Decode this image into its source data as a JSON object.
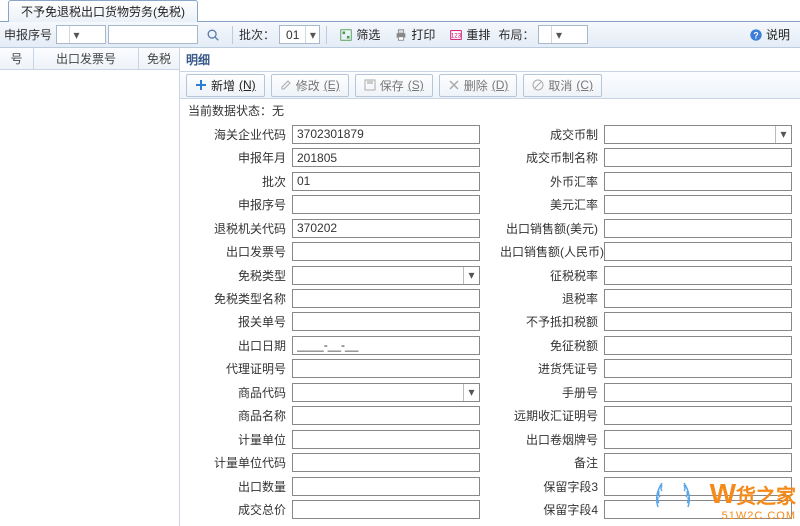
{
  "tab_title": "不予免退税出口货物劳务(免税)",
  "toolbar": {
    "sbxh_label": "申报序号",
    "sbxh_value": "",
    "search_label": "",
    "batch_label": "批次：",
    "batch_value": "01",
    "filter_label": "筛选",
    "print_label": "打印",
    "reorder_label": "重排",
    "layout_label": "布局：",
    "help_label": "说明"
  },
  "grid_headers": [
    "号",
    "出口发票号",
    "免税"
  ],
  "section_title": "明细",
  "actions": {
    "add": "新增",
    "add_key": "(N)",
    "edit": "修改",
    "edit_key": "(E)",
    "save": "保存",
    "save_key": "(S)",
    "del": "删除",
    "del_key": "(D)",
    "cancel": "取消",
    "cancel_key": "(C)"
  },
  "status_label": "当前数据状态：",
  "status_value": "无",
  "left_fields": [
    {
      "label": "海关企业代码",
      "value": "3702301879",
      "type": "text"
    },
    {
      "label": "申报年月",
      "value": "201805",
      "type": "text"
    },
    {
      "label": "批次",
      "value": "01",
      "type": "text"
    },
    {
      "label": "申报序号",
      "value": "",
      "type": "text"
    },
    {
      "label": "退税机关代码",
      "value": "370202",
      "type": "text"
    },
    {
      "label": "出口发票号",
      "value": "",
      "type": "text"
    },
    {
      "label": "免税类型",
      "value": "",
      "type": "select"
    },
    {
      "label": "免税类型名称",
      "value": "",
      "type": "text"
    },
    {
      "label": "报关单号",
      "value": "",
      "type": "text"
    },
    {
      "label": "出口日期",
      "value": "____-__-__",
      "type": "text"
    },
    {
      "label": "代理证明号",
      "value": "",
      "type": "text"
    },
    {
      "label": "商品代码",
      "value": "",
      "type": "select"
    },
    {
      "label": "商品名称",
      "value": "",
      "type": "text"
    },
    {
      "label": "计量单位",
      "value": "",
      "type": "text"
    },
    {
      "label": "计量单位代码",
      "value": "",
      "type": "text"
    },
    {
      "label": "出口数量",
      "value": "",
      "type": "text"
    },
    {
      "label": "成交总价",
      "value": "",
      "type": "text"
    }
  ],
  "right_fields": [
    {
      "label": "成交币制",
      "value": "",
      "type": "select"
    },
    {
      "label": "成交币制名称",
      "value": "",
      "type": "text"
    },
    {
      "label": "外币汇率",
      "value": "",
      "type": "text"
    },
    {
      "label": "美元汇率",
      "value": "",
      "type": "text"
    },
    {
      "label": "出口销售额(美元)",
      "value": "",
      "type": "text"
    },
    {
      "label": "出口销售额(人民币)",
      "value": "",
      "type": "text"
    },
    {
      "label": "征税税率",
      "value": "",
      "type": "text"
    },
    {
      "label": "退税率",
      "value": "",
      "type": "text"
    },
    {
      "label": "不予抵扣税额",
      "value": "",
      "type": "text"
    },
    {
      "label": "免征税额",
      "value": "",
      "type": "text"
    },
    {
      "label": "进货凭证号",
      "value": "",
      "type": "text"
    },
    {
      "label": "手册号",
      "value": "",
      "type": "text"
    },
    {
      "label": "远期收汇证明号",
      "value": "",
      "type": "text"
    },
    {
      "label": "出口卷烟牌号",
      "value": "",
      "type": "text"
    },
    {
      "label": "备注",
      "value": "",
      "type": "text"
    },
    {
      "label": "保留字段3",
      "value": "",
      "type": "text"
    },
    {
      "label": "保留字段4",
      "value": "",
      "type": "text"
    }
  ],
  "watermark": {
    "brand": "货之家",
    "url": "51W2C.COM"
  }
}
